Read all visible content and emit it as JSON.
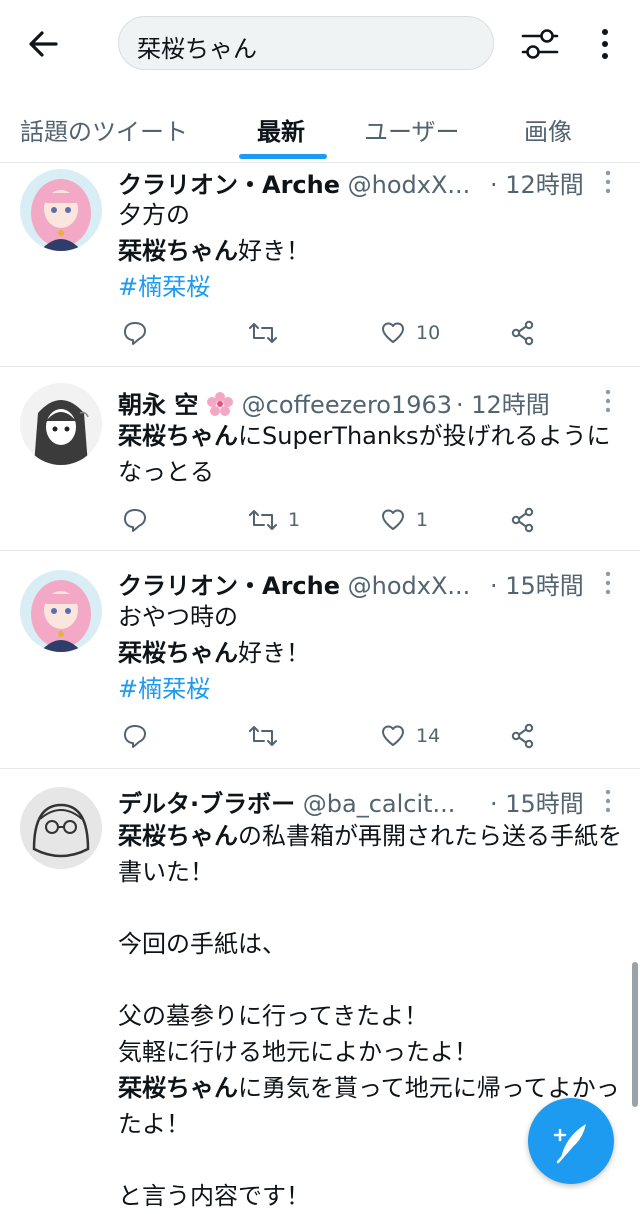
{
  "search": {
    "query": "栞桜ちゃん"
  },
  "tabs": [
    "話題のツイート",
    "最新",
    "ユーザー",
    "画像"
  ],
  "tweets": [
    {
      "name": "クラリオン・Arche",
      "handle": "@hodxX...",
      "time": "· 12時間",
      "lines": [
        "夕方の",
        "栞桜ちゃん",
        "好き！"
      ],
      "hashtag": "#楠栞桜",
      "reply": "",
      "retweet": "",
      "like": "10"
    },
    {
      "name": "朝永 空",
      "handle": "@coffeezero1963",
      "time": "· 12時間",
      "lines": [
        "栞桜ちゃん",
        "にSuperThanksが投げれるようになっとる"
      ],
      "reply": "",
      "retweet": "1",
      "like": "1"
    },
    {
      "name": "クラリオン・Arche",
      "handle": "@hodxX...",
      "time": "· 15時間",
      "lines": [
        "おやつ時の",
        "栞桜ちゃん",
        "好き！"
      ],
      "hashtag": "#楠栞桜",
      "reply": "",
      "retweet": "",
      "like": "14"
    },
    {
      "name": "デルタ·ブラボー",
      "handle": "@ba_calcit...",
      "time": "· 15時間",
      "lines": [
        "栞桜ちゃん",
        "の私書箱が再開されたら送る手紙を書いた！",
        "今回の手紙は、",
        "父の墓参りに行ってきたよ！",
        "気軽に行ける地元によかったよ！",
        "栞桜ちゃん",
        "に勇気を貰って地元に帰ってよかったよ！",
        "と言う内容です！"
      ]
    }
  ],
  "colors": {
    "accent": "#1d9bf0",
    "secondary_text": "#536471"
  },
  "icons": [
    "back-arrow-icon",
    "filter-icon",
    "more-vertical-icon",
    "reply-icon",
    "retweet-icon",
    "like-icon",
    "share-icon",
    "compose-icon"
  ]
}
